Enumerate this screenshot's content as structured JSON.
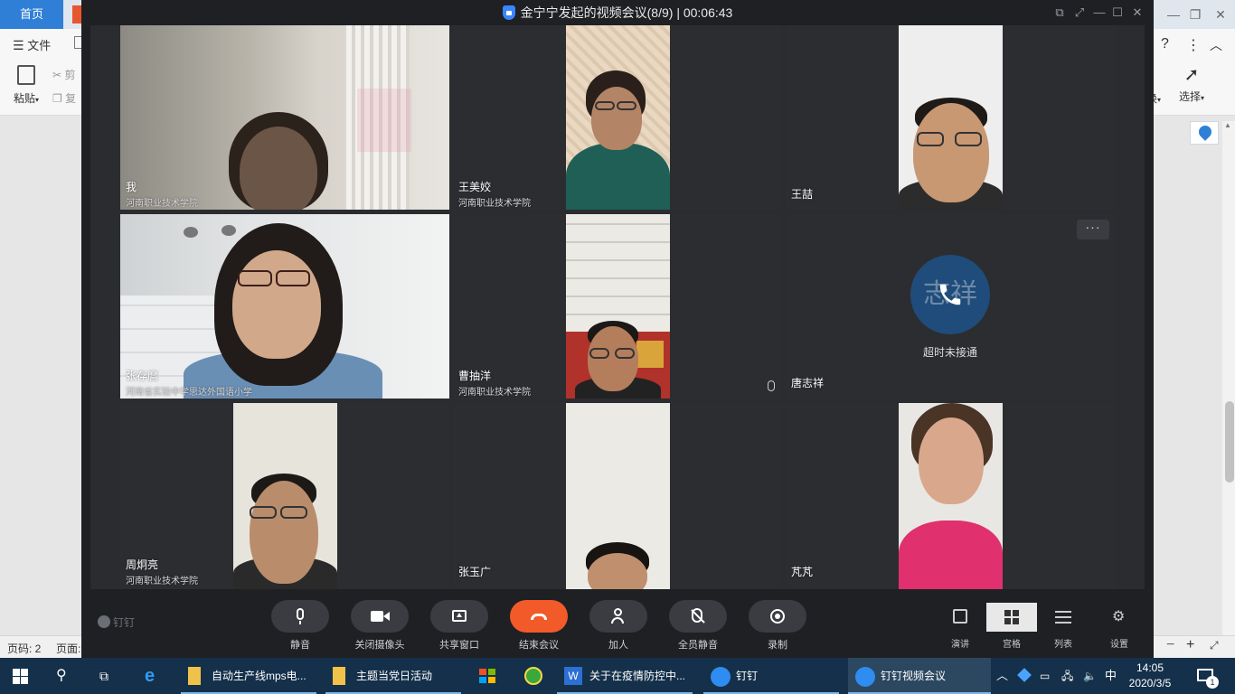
{
  "wps": {
    "home_tab": "首页",
    "menu_file": "文件",
    "paste_label": "粘贴",
    "cut_label": "剪",
    "copy_label": "复",
    "help_glyph": "?",
    "select_label": "选择",
    "switch_label": "换",
    "status_page": "页码: 2",
    "status_page2": "页面:",
    "zoom_minus": "−",
    "zoom_plus": "+"
  },
  "meeting": {
    "title": "金宁宁发起的视频会议(8/9) | 00:06:43",
    "participants": [
      {
        "name": "我",
        "org": "河南职业技术学院"
      },
      {
        "name": "王美姣",
        "org": "河南职业技术学院"
      },
      {
        "name": "王喆",
        "org": ""
      },
      {
        "name": "张存麿",
        "org": "河南省实验中学思达外国语小学"
      },
      {
        "name": "曹抽洋",
        "org": "河南职业技术学院"
      },
      {
        "name": "唐志祥",
        "org": "",
        "avatar_text": "志祥",
        "status": "超时未接通"
      },
      {
        "name": "周炯亮",
        "org": "河南职业技术学院"
      },
      {
        "name": "张玉广",
        "org": ""
      },
      {
        "name": "芃芃",
        "org": ""
      }
    ],
    "toolbar": {
      "logo": "钉钉",
      "mute": "静音",
      "camera_off": "关闭摄像头",
      "share_window": "共享窗口",
      "end_meeting": "结束会议",
      "add_person": "加人",
      "mute_all": "全员静音",
      "record": "录制",
      "layout_speaker": "演讲",
      "layout_grid": "宫格",
      "layout_list": "列表",
      "settings": "设置"
    },
    "colors": {
      "end_button": "#f25a29",
      "avatar_bg": "#1f4c7a",
      "window_bg": "#1e2024"
    }
  },
  "taskbar": {
    "items": [
      {
        "label": "自动生产线mps电..."
      },
      {
        "label": "主题当党日活动"
      },
      {
        "label": "关于在疫情防控中..."
      },
      {
        "label": "钉钉"
      },
      {
        "label": "钉钉视频会议"
      }
    ],
    "ime": "中",
    "time": "14:05",
    "date": "2020/3/5",
    "notification_count": "1"
  }
}
